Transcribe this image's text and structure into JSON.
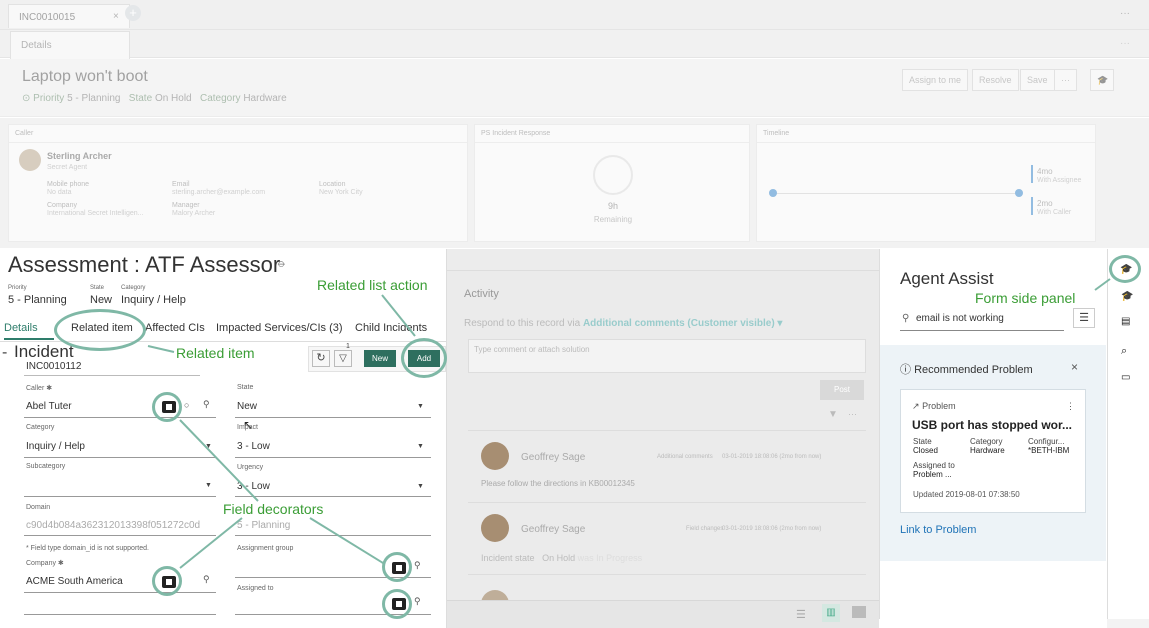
{
  "tabs": {
    "record_tab": "INC0010015",
    "close": "×",
    "add": "+",
    "more": "···"
  },
  "subtab": {
    "details": "Details",
    "more": "···"
  },
  "record": {
    "title": "Laptop won't boot",
    "priority_label": "Priority",
    "priority_value": "5 - Planning",
    "state_label": "State",
    "state_value": "On Hold",
    "category_label": "Category",
    "category_value": "Hardware",
    "buttons": {
      "assign": "Assign to me",
      "resolve": "Resolve",
      "save": "Save",
      "more": "···"
    }
  },
  "caller_card": {
    "header": "Caller",
    "name": "Sterling Archer",
    "role": "Secret Agent",
    "mobile_label": "Mobile phone",
    "mobile_value": "No data",
    "email_label": "Email",
    "email_value": "sterling.archer@example.com",
    "location_label": "Location",
    "location_value": "New York City",
    "company_label": "Company",
    "company_value": "International Secret Intelligen...",
    "manager_label": "Manager",
    "manager_value": "Malory Archer"
  },
  "ps_card": {
    "header": "PS Incident Response",
    "time": "9h",
    "remaining": "Remaining"
  },
  "timeline_card": {
    "header": "Timeline",
    "e1_time": "4mo",
    "e1_label": "With Assignee",
    "e2_time": "2mo",
    "e2_label": "With Caller"
  },
  "form": {
    "title": "Assessment : ATF Assessor",
    "priority_label": "Priority",
    "priority_value": "5 - Planning",
    "state_label": "State",
    "state_value": "New",
    "category_label": "Category",
    "category_value": "Inquiry / Help",
    "tabs": [
      "Details",
      "Related item",
      "Affected CIs",
      "Impacted Services/CIs (3)",
      "Child Incidents"
    ],
    "section": "Incident",
    "number": "INC0010112",
    "new_btn": "New",
    "add_btn": "Add",
    "filter_badge": "1",
    "caller_label": "Caller ✱",
    "caller_value": "Abel Tuter",
    "state_field_label": "State",
    "state_field_value": "New",
    "category_field_label": "Category",
    "category_field_value": "Inquiry / Help",
    "impact_label": "Impact",
    "impact_value": "3 - Low",
    "subcategory_label": "Subcategory",
    "urgency_label": "Urgency",
    "urgency_value": "3 - Low",
    "domain_label": "Domain",
    "domain_value": "c90d4b084a362312013398f051272c0d",
    "priority_field_value": "5 - Planning",
    "domain_note": "* Field type domain_id is not supported.",
    "company_label": "Company ✱",
    "company_value": "ACME South America",
    "assignment_group_label": "Assignment group",
    "assigned_to_label": "Assigned to"
  },
  "activity": {
    "title": "Activity",
    "respond_text": "Respond to this record via",
    "respond_link": "Additional comments (Customer visible) ▾",
    "placeholder": "Type comment or attach solution",
    "post": "Post",
    "entries": [
      {
        "name": "Geoffrey Sage",
        "type": "Additional comments",
        "time": "03-01-2019 18:08:06 (2mo from now)",
        "body": "Please follow the directions in KB00012345"
      },
      {
        "name": "Geoffrey Sage",
        "type": "Field changes",
        "time": "03-01-2019 18:08:06 (2mo from now)",
        "field": "Incident state",
        "value": "On Hold",
        "was": "was In Progress"
      }
    ]
  },
  "agent_assist": {
    "title": "Agent Assist",
    "search_value": "email is not working",
    "section_title": "Recommended Problem",
    "close": "×",
    "card_type": "Problem",
    "card_more": "⋮",
    "card_title": "USB port has stopped wor...",
    "state_label": "State",
    "state_value": "Closed",
    "category_label": "Category",
    "category_value": "Hardware",
    "config_label": "Configur...",
    "config_value": "*BETH-IBM",
    "assigned_label": "Assigned to",
    "assigned_value": "Problem ...",
    "updated": "Updated 2019-08-01 07:38:50",
    "link": "Link to Problem"
  },
  "annotations": {
    "related_list_action": "Related list action",
    "form_side_panel": "Form side panel",
    "related_item": "Related item",
    "field_decorators": "Field decorators"
  },
  "colors": {
    "accent": "#2e7d6b",
    "annotation": "#3a9d35",
    "circle": "#7fb8a6",
    "link": "#1f73b7"
  }
}
